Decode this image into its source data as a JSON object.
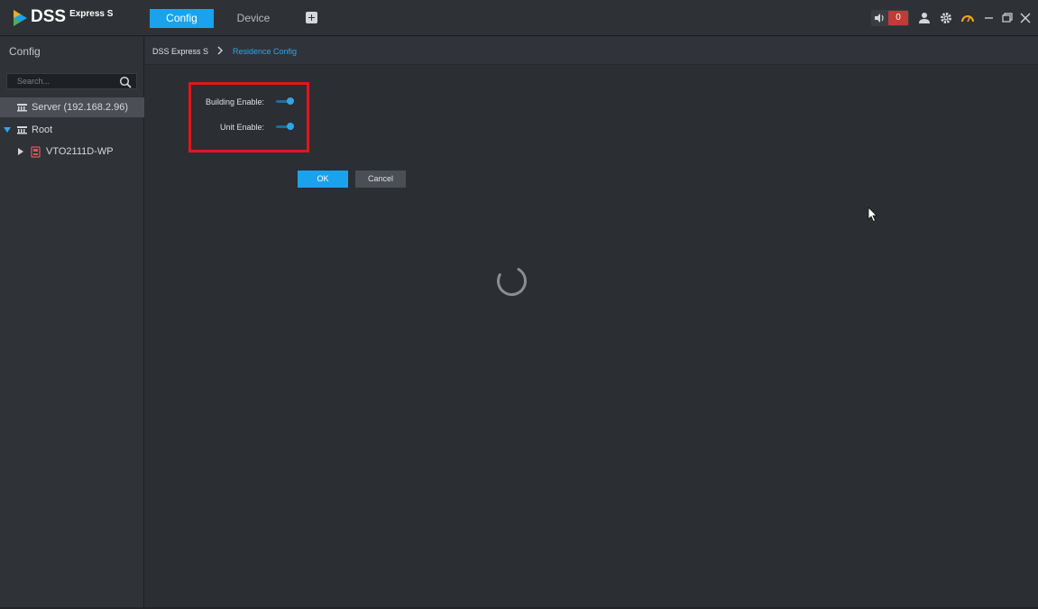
{
  "app": {
    "logo_text": "DSS",
    "logo_sub": "Express S"
  },
  "tabs": [
    {
      "label": "Config",
      "active": true
    },
    {
      "label": "Device",
      "active": false
    }
  ],
  "header": {
    "alarm_count": "0"
  },
  "sidebar": {
    "title": "Config",
    "search_placeholder": "Search...",
    "tree": [
      {
        "label": "Server (192.168.2.96)",
        "selected": true
      },
      {
        "label": "Root",
        "expanded": true
      },
      {
        "label": "VTO2111D-WP",
        "expanded": false
      }
    ]
  },
  "breadcrumb": {
    "root": "DSS Express S",
    "current": "Residence Config"
  },
  "form": {
    "building_enable_label": "Building Enable:",
    "building_enable_on": true,
    "unit_enable_label": "Unit Enable:",
    "unit_enable_on": true,
    "ok_label": "OK",
    "cancel_label": "Cancel"
  },
  "colors": {
    "accent": "#1aa3ec",
    "highlight_box": "#e1161c",
    "alarm_badge": "#c33a36"
  }
}
